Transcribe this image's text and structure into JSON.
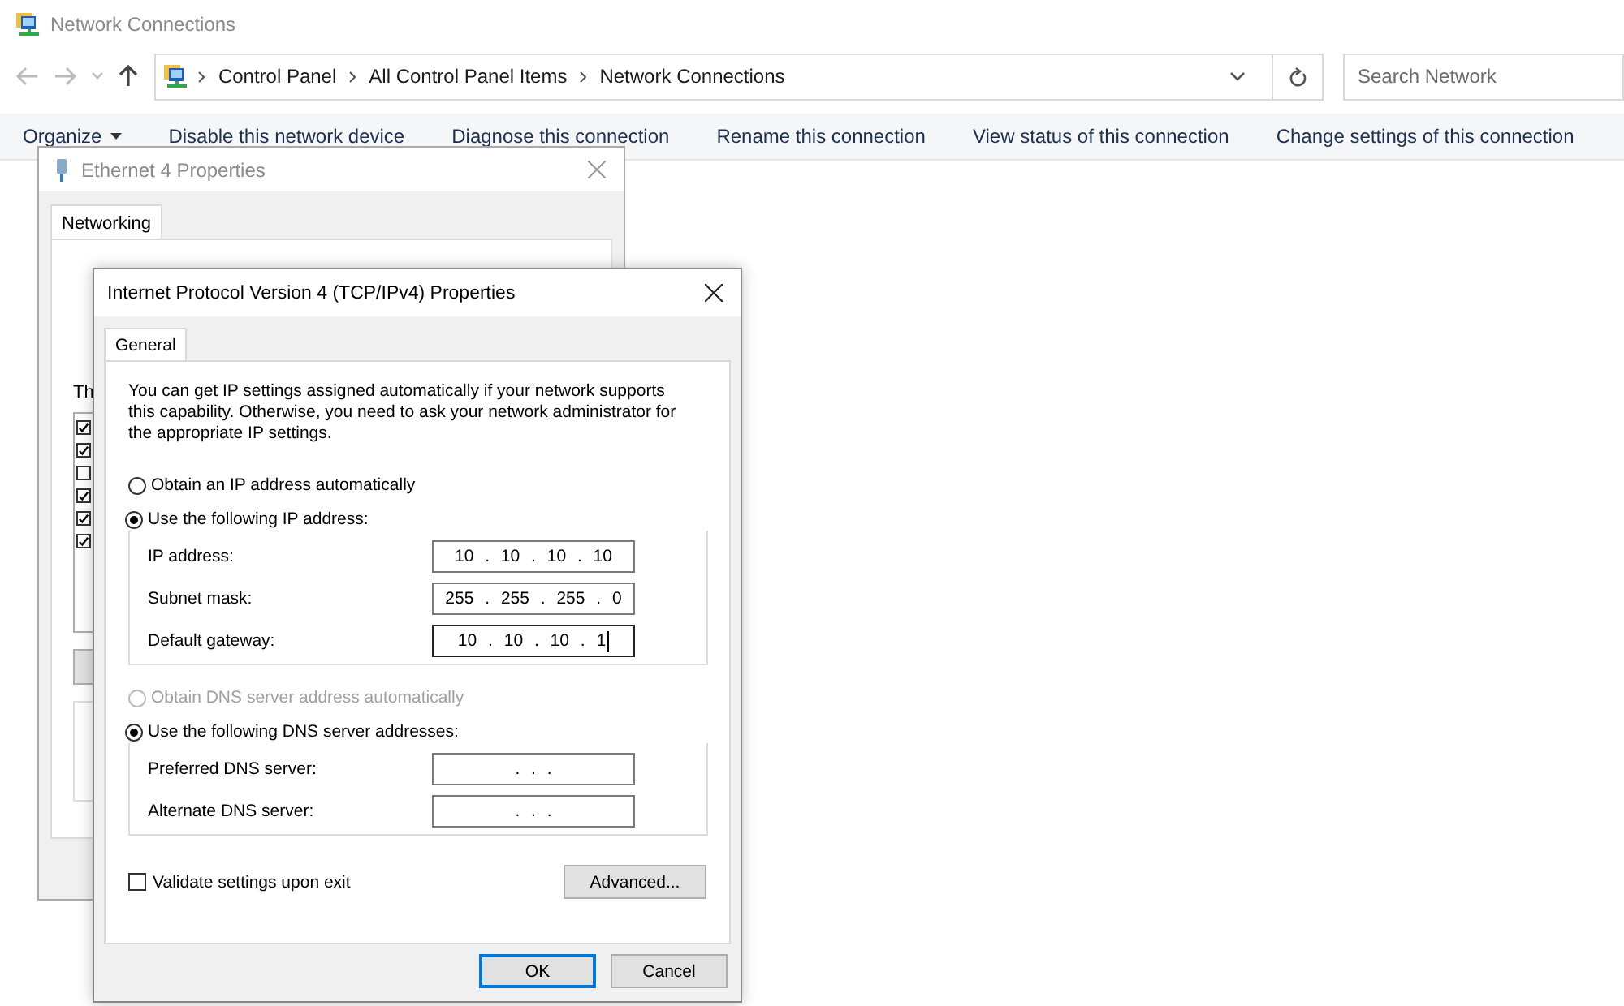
{
  "window": {
    "title": "Network Connections"
  },
  "address_bar": {
    "breadcrumbs": [
      "Control Panel",
      "All Control Panel Items",
      "Network Connections"
    ]
  },
  "search": {
    "placeholder": "Search Network"
  },
  "toolbar": [
    {
      "label": "Organize",
      "kind": "menu"
    },
    {
      "label": "Disable this network device",
      "kind": "command"
    },
    {
      "label": "Diagnose this connection",
      "kind": "command"
    },
    {
      "label": "Rename this connection",
      "kind": "command"
    },
    {
      "label": "View status of this connection",
      "kind": "command"
    },
    {
      "label": "Change settings of this connection",
      "kind": "command"
    }
  ],
  "ethernet_dialog": {
    "title": "Ethernet 4 Properties",
    "tabs": [
      {
        "label": "Networking",
        "selected": true
      }
    ],
    "list_label": "Th",
    "components": [
      {
        "checked": true
      },
      {
        "checked": true
      },
      {
        "checked": false
      },
      {
        "checked": true
      },
      {
        "checked": true
      },
      {
        "checked": true
      }
    ]
  },
  "ipv4_dialog": {
    "title": "Internet Protocol Version 4 (TCP/IPv4) Properties",
    "tabs": [
      {
        "label": "General",
        "selected": true
      }
    ],
    "description": "You can get IP settings assigned automatically if your network supports this capability. Otherwise, you need to ask your network administrator for the appropriate IP settings.",
    "ip_mode": [
      {
        "label": "Obtain an IP address automatically",
        "selected": false,
        "disabled": false
      },
      {
        "label": "Use the following IP address:",
        "selected": true,
        "disabled": false
      }
    ],
    "ip_fields": [
      {
        "label": "IP address:",
        "value": "10 . 10 . 10 . 10",
        "focused": false
      },
      {
        "label": "Subnet mask:",
        "value": "255 . 255 . 255 . 0",
        "focused": false
      },
      {
        "label": "Default gateway:",
        "value": "10 . 10 . 10 . 1",
        "focused": true
      }
    ],
    "dns_mode": [
      {
        "label": "Obtain DNS server address automatically",
        "selected": false,
        "disabled": true
      },
      {
        "label": "Use the following DNS server addresses:",
        "selected": true,
        "disabled": false
      }
    ],
    "dns_fields": [
      {
        "label": "Preferred DNS server:",
        "value": ". . .",
        "focused": false
      },
      {
        "label": "Alternate DNS server:",
        "value": ". . .",
        "focused": false
      }
    ],
    "validate": {
      "label": "Validate settings upon exit",
      "checked": false
    },
    "advanced_button": "Advanced...",
    "buttons": [
      {
        "label": "OK",
        "default": true
      },
      {
        "label": "Cancel",
        "default": false
      }
    ]
  }
}
